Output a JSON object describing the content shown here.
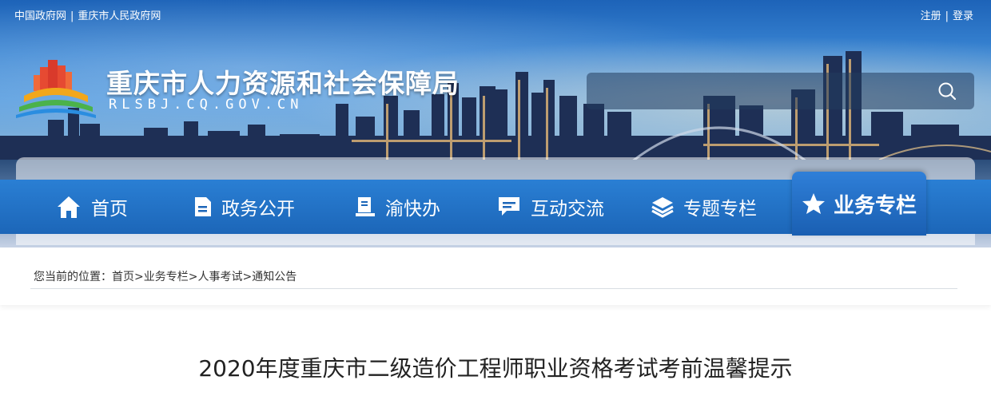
{
  "header": {
    "gov_link": "中国政府网",
    "city_link": "重庆市人民政府网",
    "register": "注册",
    "login": "登录",
    "site_title": "重庆市人力资源和社会保障局",
    "site_domain": "RLSBJ.CQ.GOV.CN"
  },
  "search": {
    "placeholder": "",
    "icon": "search-icon"
  },
  "nav": {
    "items": [
      {
        "label": "首页",
        "icon": "home-icon"
      },
      {
        "label": "政务公开",
        "icon": "document-icon"
      },
      {
        "label": "渝快办",
        "icon": "book-icon"
      },
      {
        "label": "互动交流",
        "icon": "chat-icon"
      },
      {
        "label": "专题专栏",
        "icon": "layers-icon"
      }
    ],
    "active": {
      "label": "业务专栏",
      "icon": "star-icon"
    }
  },
  "breadcrumb": {
    "prefix": "您当前的位置：",
    "items": [
      "首页",
      "业务专栏",
      "人事考试",
      "通知公告"
    ],
    "separator": ">"
  },
  "article": {
    "title": "2020年度重庆市二级造价工程师职业资格考试考前温馨提示"
  },
  "colors": {
    "nav_blue": "#1c66b8",
    "accent": "#2a7fd4"
  }
}
